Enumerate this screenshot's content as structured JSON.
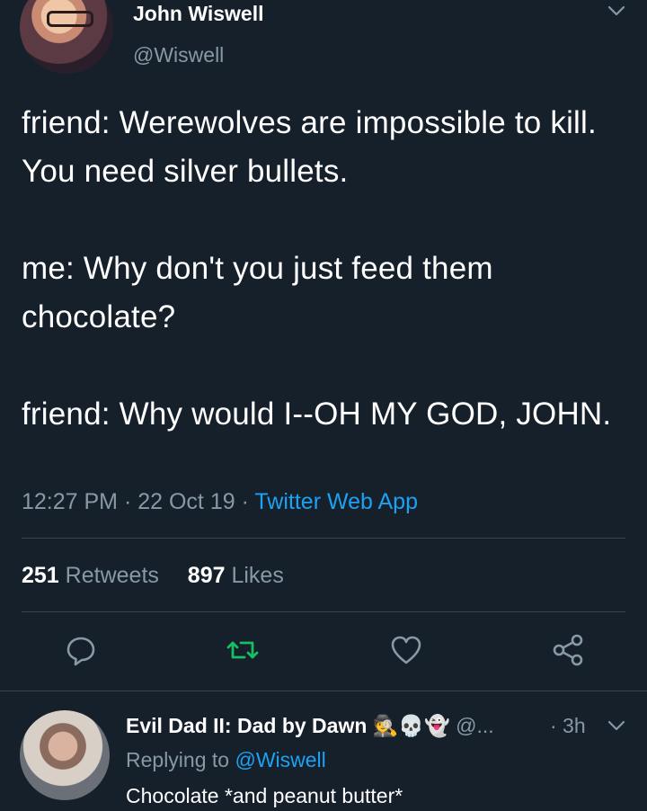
{
  "tweet": {
    "author_name": "John Wiswell",
    "author_handle": "@Wiswell",
    "text": "friend: Werewolves are impossible to kill. You need silver bullets.\n\nme: Why don't you just feed them chocolate?\n\nfriend: Why would I--OH MY GOD, JOHN.",
    "time": "12:27 PM",
    "sep1": " · ",
    "date": "22 Oct 19",
    "sep2": " · ",
    "source": "Twitter Web App",
    "retweets_count": "251",
    "retweets_label": "Retweets",
    "likes_count": "897",
    "likes_label": "Likes"
  },
  "actions": {
    "reply_icon": "comment-icon",
    "retweet_icon": "retweet-icon",
    "like_icon": "heart-icon",
    "share_icon": "share-icon"
  },
  "reply": {
    "author_name": "Evil Dad II: Dad by Dawn",
    "emojis": "🕵💀👻",
    "author_handle": "@...",
    "time": "· 3h",
    "replying_prefix": "Replying to",
    "replying_to": "@Wiswell",
    "text": "Chocolate *and peanut butter*"
  },
  "colors": {
    "background": "#15202b",
    "secondary_text": "#8899a6",
    "link": "#1da1f2",
    "retweet_green": "#17bf63"
  }
}
